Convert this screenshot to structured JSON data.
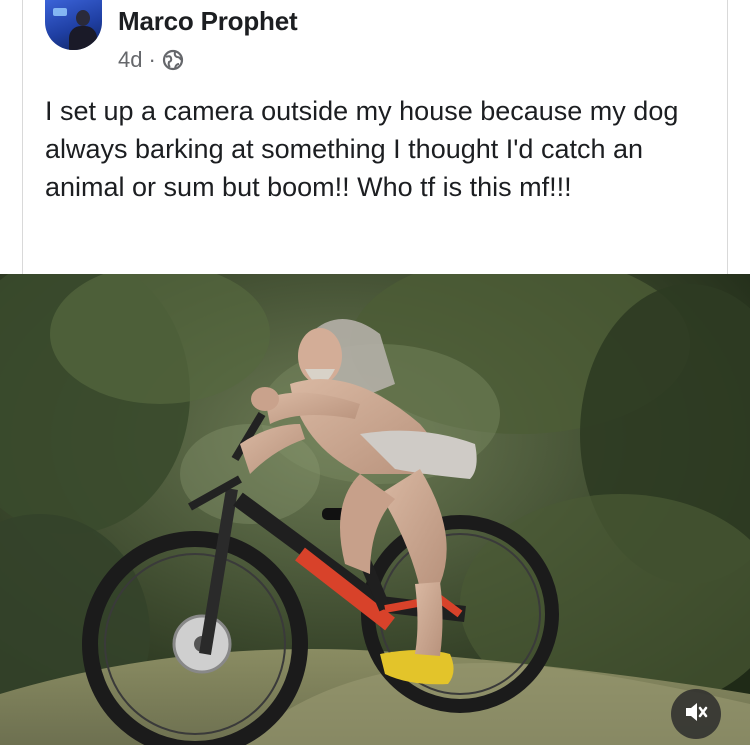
{
  "post": {
    "author": "Marco Prophet",
    "time": "4d",
    "separator": "·",
    "privacy_icon": "globe-icon",
    "text": "I set up a camera outside my house because my dog always barking at something I thought I'd catch an animal or sum but boom!! Who tf is this mf!!!"
  },
  "photo": {
    "subject": "man riding mountain bike through forest trail",
    "mute_icon": "speaker-muted-icon"
  },
  "colors": {
    "text_primary": "#1c1e21",
    "text_secondary": "#65676b",
    "forest_dark": "#2c3a24",
    "bike_accent": "#d8422a"
  }
}
